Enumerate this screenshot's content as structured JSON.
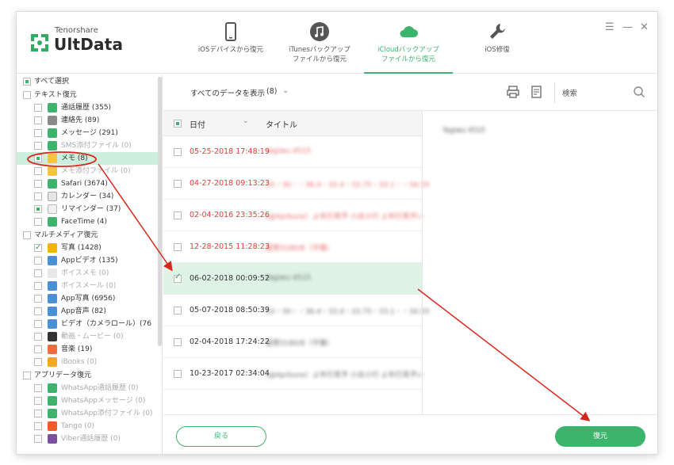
{
  "app": {
    "brand_small": "Tenorshare",
    "brand_big": "UltData"
  },
  "tabs": [
    {
      "label": "iOSデバイスから復元",
      "icon": "phone-icon",
      "active": false
    },
    {
      "label": "iTunesバックアップ\nファイルから復元",
      "icon": "music-note-icon",
      "active": false
    },
    {
      "label": "iCloudバックアップ\nファイルから復元",
      "icon": "cloud-icon",
      "active": true
    },
    {
      "label": "iOS修復",
      "icon": "wrench-icon",
      "active": false
    }
  ],
  "window_controls": {
    "menu": "☰",
    "minimize": "—",
    "close": "✕"
  },
  "sidebar": {
    "select_all": "すべて選択",
    "sections": {
      "text": "テキスト復元",
      "media": "マルチメディア復元",
      "app": "アプリデータ復元"
    },
    "items": [
      {
        "label": "通話履歴 (355)"
      },
      {
        "label": "連絡先 (89)"
      },
      {
        "label": "メッセージ (291)"
      },
      {
        "label": "SMS添付ファイル (0)"
      },
      {
        "label": "メモ (8)"
      },
      {
        "label": "メモ添付ファイル (0)"
      },
      {
        "label": "Safari (3674)"
      },
      {
        "label": "カレンダー (34)"
      },
      {
        "label": "リマインダー (37)"
      },
      {
        "label": "FaceTime (4)"
      },
      {
        "label": "写真 (1428)"
      },
      {
        "label": "Appビデオ (135)"
      },
      {
        "label": "ボイスメモ (0)"
      },
      {
        "label": "ボイスメール (0)"
      },
      {
        "label": "App写真 (6956)"
      },
      {
        "label": "App音声 (82)"
      },
      {
        "label": "ビデオ（カメラロール）(76"
      },
      {
        "label": "動画・ムービー (0)"
      },
      {
        "label": "音楽 (19)"
      },
      {
        "label": "iBooks (0)"
      },
      {
        "label": "WhatsApp通話履歴 (0)"
      },
      {
        "label": "WhatsAppメッセージ (0)"
      },
      {
        "label": "WhatsApp添付ファイル (0)"
      },
      {
        "label": "Tango (0)"
      },
      {
        "label": "Viber通話履歴 (0)"
      }
    ]
  },
  "toolbar": {
    "filter_label": "すべてのデータを表示",
    "filter_count": "(8)",
    "search_label": "検索"
  },
  "list": {
    "header_date": "日付",
    "header_title": "タイトル",
    "rows": [
      {
        "date": "05-25-2018 17:48:19",
        "title": "Yagiwu 4515"
      },
      {
        "date": "04-27-2018 09:13:23",
        "title": "10・30・・36.4・33.4・33.75・33.1・・34.55"
      },
      {
        "date": "02-04-2016 23:35:26",
        "title": "(@Aprkune）よ年打見予 小去小行 よ年打見予い"
      },
      {
        "date": "12-28-2015 11:28:23",
        "title": "星照3180/8（平雅）"
      },
      {
        "date": "06-02-2018 00:09:52",
        "title": "Yagiwu 4515"
      },
      {
        "date": "05-07-2018 08:50:39",
        "title": "10・30・・36.4・33.4・33.75・33.1・・34.55"
      },
      {
        "date": "02-04-2018 17:24:22",
        "title": "星照3180/8（平雅）"
      },
      {
        "date": "10-23-2017 02:34:04",
        "title": "(@Aprkune）よ年打見予 小去小行 よ年打見予い"
      }
    ]
  },
  "detail": {
    "text": "Yagiwu 4515"
  },
  "footer": {
    "back_label": "戻る",
    "recover_label": "復元"
  },
  "colors": {
    "accent": "#3bb46c",
    "deleted": "#e23b3b",
    "annotation": "#d9261c"
  }
}
